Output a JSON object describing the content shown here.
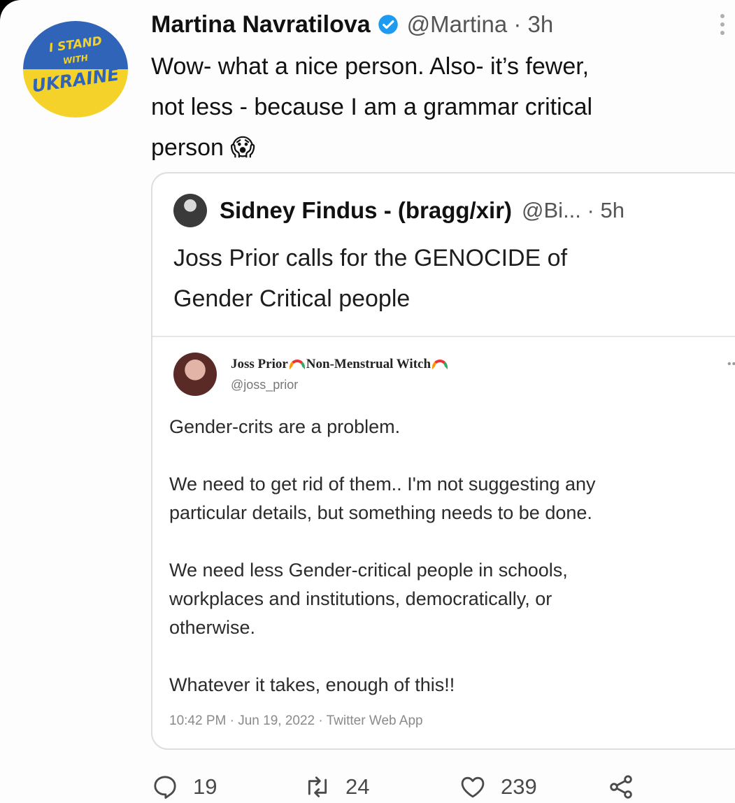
{
  "tweet": {
    "avatar_text": [
      "I STAND",
      "WITH",
      "UKRAINE"
    ],
    "author_name": "Martina Navratilova",
    "handle": "@Martina · 3h",
    "text": "Wow- what a nice person. Also- it’s fewer,\nnot less - because I am a grammar critical\nperson 😱"
  },
  "quote": {
    "author_name": "Sidney Findus - (bragg/xir)",
    "handle": "@Bi... · 5h",
    "text": "Joss Prior calls for the GENOCIDE of\nGender Critical people",
    "embedded": {
      "name": "Joss Prior",
      "title": "Non-Menstrual Witch",
      "handle": "@joss_prior",
      "text": "Gender-crits are a problem.\n\nWe need to get rid of them.. I'm not suggesting any\nparticular details, but something needs to be done.\n\nWe need less Gender-critical people in schools,\nworkplaces and institutions, democratically, or\notherwise.\n\nWhatever it takes, enough of this!!",
      "meta": "10:42 PM · Jun 19, 2022 · Twitter Web App"
    }
  },
  "actions": {
    "replies": "19",
    "retweets": "24",
    "likes": "239"
  },
  "colors": {
    "verified": "#1d9bf0",
    "ukraine_blue": "#2f64b9",
    "ukraine_yellow": "#f4d22a"
  }
}
